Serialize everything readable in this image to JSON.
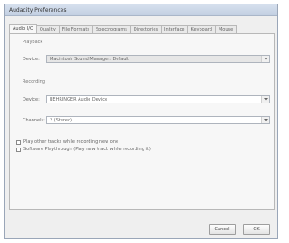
{
  "window": {
    "title": "Audacity Preferences"
  },
  "tabs": [
    {
      "label": "Audio I/O",
      "active": true
    },
    {
      "label": "Quality",
      "active": false
    },
    {
      "label": "File Formats",
      "active": false
    },
    {
      "label": "Spectrograms",
      "active": false
    },
    {
      "label": "Directories",
      "active": false
    },
    {
      "label": "Interface",
      "active": false
    },
    {
      "label": "Keyboard",
      "active": false
    },
    {
      "label": "Mouse",
      "active": false
    }
  ],
  "playback": {
    "group_label": "Playback",
    "device_label": "Device:",
    "device_value": "Macintosh Sound Manager: Default"
  },
  "recording": {
    "group_label": "Recording",
    "device_label": "Device:",
    "device_value": "BEHRINGER Audio Device",
    "channels_label": "Channels:",
    "channels_value": "2 (Stereo)"
  },
  "options": {
    "play_other_tracks": "Play other tracks while recording new one",
    "software_playthrough": "Software Playthrough (Play new track while recording it)"
  },
  "buttons": {
    "cancel": "Cancel",
    "ok": "OK"
  }
}
